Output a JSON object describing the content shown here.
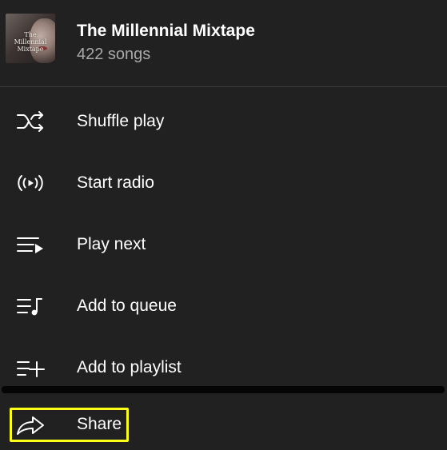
{
  "header": {
    "title": "The Millennial Mixtape",
    "subtitle": "422 songs",
    "thumbnail_text": "The Millennial Mixtape"
  },
  "menu": {
    "items": [
      {
        "label": "Shuffle play",
        "icon": "shuffle-icon"
      },
      {
        "label": "Start radio",
        "icon": "radio-icon"
      },
      {
        "label": "Play next",
        "icon": "play-next-icon"
      },
      {
        "label": "Add to queue",
        "icon": "add-to-queue-icon"
      },
      {
        "label": "Add to playlist",
        "icon": "add-to-playlist-icon"
      },
      {
        "label": "Share",
        "icon": "share-icon"
      }
    ]
  },
  "colors": {
    "background": "#212121",
    "text": "#ffffff",
    "subtext": "#a9a9a9",
    "highlight": "#ffff1a"
  }
}
